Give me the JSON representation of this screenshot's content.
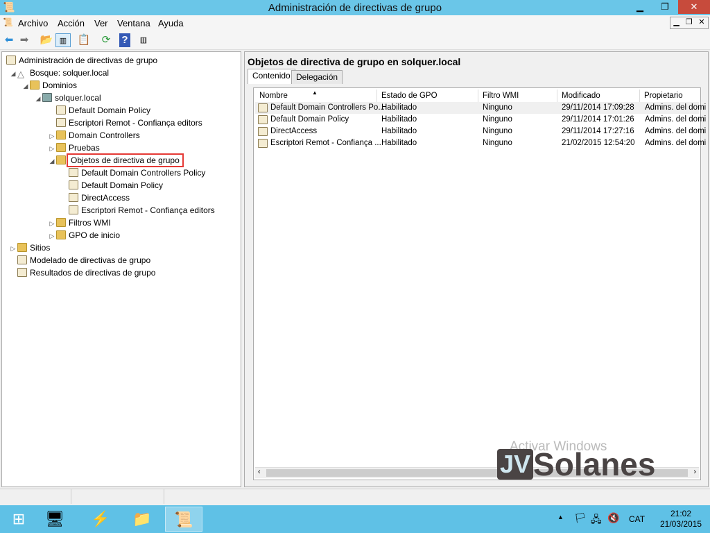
{
  "window": {
    "title": "Administración de directivas de grupo",
    "controls": [
      "minimize",
      "restore",
      "close"
    ]
  },
  "menu": [
    "Archivo",
    "Acción",
    "Ver",
    "Ventana",
    "Ayuda"
  ],
  "toolbar": [
    "back-icon",
    "forward-icon",
    "up-folder-icon",
    "show-hide-tree-icon",
    "properties-icon",
    "refresh-icon",
    "help-icon",
    "action-pane-icon"
  ],
  "tree": [
    {
      "label": "Administración de directivas de grupo",
      "level": 0,
      "expander": "",
      "icon": "gpmc"
    },
    {
      "label": "Bosque: solquer.local",
      "level": 1,
      "expander": "◢",
      "icon": "forest"
    },
    {
      "label": "Dominios",
      "level": 2,
      "expander": "◢",
      "icon": "folder"
    },
    {
      "label": "solquer.local",
      "level": 3,
      "expander": "◢",
      "icon": "domain"
    },
    {
      "label": "Default Domain Policy",
      "level": 4,
      "expander": "",
      "icon": "gpo-link"
    },
    {
      "label": "Escriptori Remot - Confiança editors",
      "level": 4,
      "expander": "",
      "icon": "gpo-link"
    },
    {
      "label": "Domain Controllers",
      "level": 4,
      "expander": "▷",
      "icon": "folder"
    },
    {
      "label": "Pruebas",
      "level": 4,
      "expander": "▷",
      "icon": "folder"
    },
    {
      "label": "Objetos de directiva de grupo",
      "level": 4,
      "expander": "◢",
      "icon": "folder",
      "selected": true
    },
    {
      "label": "Default Domain Controllers Policy",
      "level": 5,
      "expander": "",
      "icon": "doc"
    },
    {
      "label": "Default Domain Policy",
      "level": 5,
      "expander": "",
      "icon": "doc"
    },
    {
      "label": "DirectAccess",
      "level": 5,
      "expander": "",
      "icon": "doc"
    },
    {
      "label": "Escriptori Remot - Confiança editors",
      "level": 5,
      "expander": "",
      "icon": "doc"
    },
    {
      "label": "Filtros WMI",
      "level": 4,
      "expander": "▷",
      "icon": "folder"
    },
    {
      "label": "GPO de inicio",
      "level": 4,
      "expander": "▷",
      "icon": "folder"
    },
    {
      "label": "Sitios",
      "level": 1,
      "expander": "▷",
      "icon": "folder"
    },
    {
      "label": "Modelado de directivas de grupo",
      "level": 1,
      "expander": "",
      "icon": "doc"
    },
    {
      "label": "Resultados de directivas de grupo",
      "level": 1,
      "expander": "",
      "icon": "doc"
    }
  ],
  "right": {
    "title": "Objetos de directiva de grupo en solquer.local",
    "tabs": [
      "Contenido",
      "Delegación"
    ],
    "columns": [
      "Nombre",
      "Estado de GPO",
      "Filtro WMI",
      "Modificado",
      "Propietario"
    ],
    "rows": [
      [
        "Default Domain Controllers Po...",
        "Habilitado",
        "Ninguno",
        "29/11/2014 17:09:28",
        "Admins. del domi"
      ],
      [
        "Default Domain Policy",
        "Habilitado",
        "Ninguno",
        "29/11/2014 17:01:26",
        "Admins. del domi"
      ],
      [
        "DirectAccess",
        "Habilitado",
        "Ninguno",
        "29/11/2014 17:27:16",
        "Admins. del domi"
      ],
      [
        "Escriptori Remot - Confiança ...",
        "Habilitado",
        "Ninguno",
        "21/02/2015 12:54:20",
        "Admins. del domi"
      ]
    ]
  },
  "watermark": {
    "activation": "Activar Windows",
    "logo": "JVSolanes"
  },
  "taskbar": {
    "lang": "CAT",
    "time": "21:02",
    "date": "21/03/2015",
    "colors": {
      "taskbar": "#5fc1e6",
      "titlebar": "#6ac6e8",
      "highlight": "#e53935"
    }
  }
}
